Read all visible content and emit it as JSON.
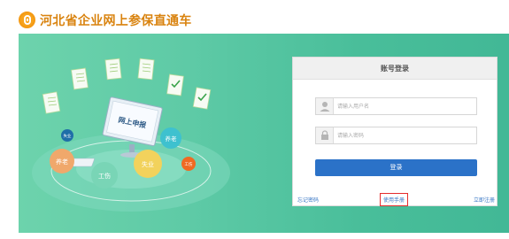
{
  "site": {
    "title": "河北省企业网上参保直通车"
  },
  "illustration": {
    "screen_text": "网上申报",
    "bubbles": [
      "养老",
      "失业",
      "工伤",
      "养老",
      "失业",
      "工伤"
    ]
  },
  "login": {
    "title": "账号登录",
    "username_placeholder": "请输入用户名",
    "password_placeholder": "请输入密码",
    "submit_label": "登录",
    "forgot_label": "忘记密码",
    "manual_label": "使用手册",
    "register_label": "立即注册"
  },
  "colors": {
    "brand": "#d9830f",
    "banner_green": "#4cc09c",
    "button_blue": "#2b72c8",
    "highlight_red": "#e52c2c"
  }
}
